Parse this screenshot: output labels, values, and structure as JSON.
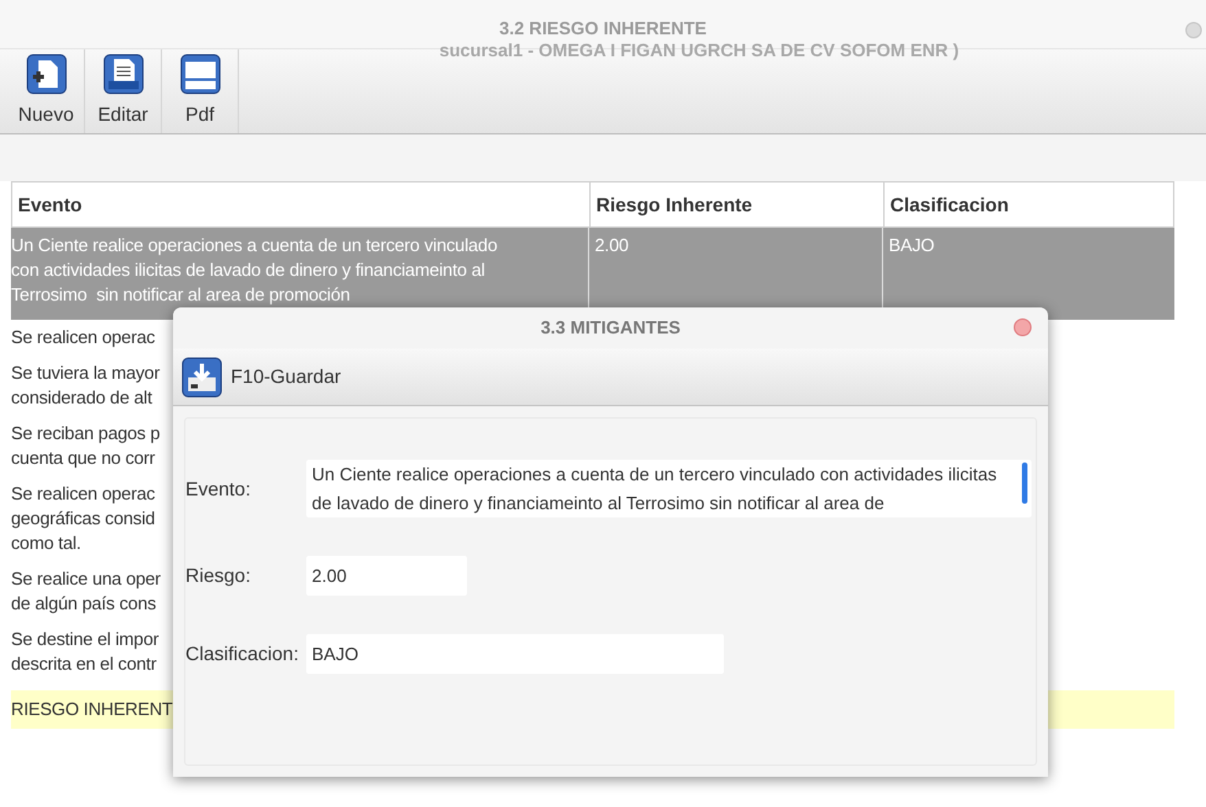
{
  "window": {
    "title": "3.2 RIESGO INHERENTE",
    "subtitle": "sucursal1 - OMEGA I FIGAN UGRCH SA DE CV SOFOM ENR )"
  },
  "toolbar": [
    {
      "label": "Nuevo",
      "kind": "new"
    },
    {
      "label": "Editar",
      "kind": "edit"
    },
    {
      "label": "Pdf",
      "kind": "pdf"
    }
  ],
  "table": {
    "columns": [
      "Evento",
      "Riesgo Inherente",
      "Clasificacion"
    ],
    "rows": [
      {
        "selected": true,
        "kind": "row",
        "cells": [
          [
            "Un Ciente realice operaciones a cuenta de un tercero vinculado",
            "con actividades ilicitas de lavado de dinero y financiameinto al",
            "Terrosimo  sin notificar al area de promoción"
          ],
          [
            "2.00"
          ],
          [
            "BAJO"
          ]
        ]
      },
      {
        "selected": false,
        "kind": "row",
        "cells": [
          [
            "Se realicen operac"
          ]
        ]
      },
      {
        "selected": false,
        "kind": "row",
        "cells": [
          [
            "Se tuviera la mayor",
            "considerado de alt"
          ]
        ]
      },
      {
        "selected": false,
        "kind": "row",
        "cells": [
          [
            "Se reciban pagos p",
            "cuenta que no corr"
          ]
        ]
      },
      {
        "selected": false,
        "kind": "row",
        "cells": [
          [
            "Se realicen operac",
            "geográficas consid",
            "como tal."
          ]
        ]
      },
      {
        "selected": false,
        "kind": "row",
        "cells": [
          [
            "Se realice una oper",
            "de algún país cons"
          ]
        ]
      },
      {
        "selected": false,
        "kind": "row",
        "cells": [
          [
            "Se destine el impor",
            "descrita en el contr"
          ]
        ]
      },
      {
        "selected": false,
        "kind": "total",
        "cells": [
          [
            "RIESGO INHERENT"
          ]
        ]
      }
    ]
  },
  "dialog": {
    "title": "3.3 MITIGANTES",
    "save_button": "F10-Guardar",
    "fields": [
      {
        "label": "Evento:",
        "kind": "textarea",
        "value": "Un Ciente realice operaciones a cuenta de un tercero vinculado con actividades ilicitas de lavado de dinero y financiameinto al  Terrosimo  sin notificar al area de"
      },
      {
        "label": "Riesgo:",
        "kind": "short",
        "value": "2.00"
      },
      {
        "label": "Clasificacion:",
        "kind": "medium",
        "value": "BAJO"
      }
    ]
  }
}
